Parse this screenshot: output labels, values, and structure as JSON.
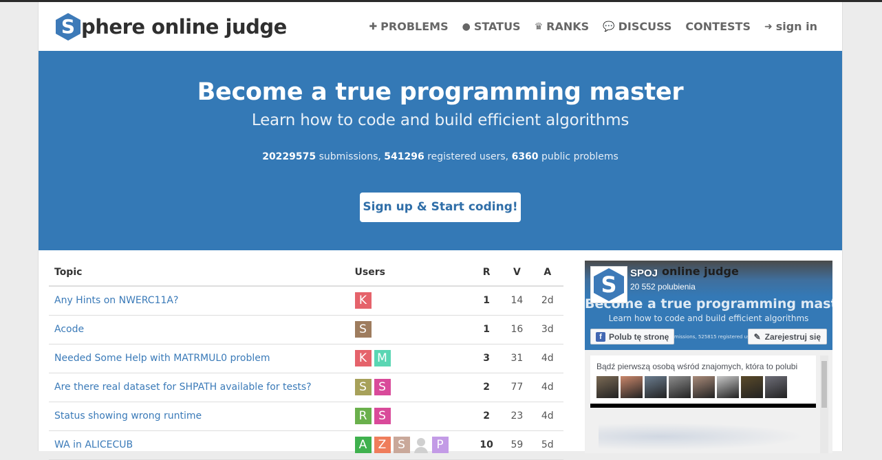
{
  "header": {
    "logo_letter": "S",
    "logo_text": "phere online judge",
    "nav": [
      {
        "label": "PROBLEMS",
        "icon": "puzzle-icon",
        "glyph": "✚"
      },
      {
        "label": "STATUS",
        "icon": "circle-icon",
        "glyph": "●"
      },
      {
        "label": "RANKS",
        "icon": "trophy-icon",
        "glyph": "♛"
      },
      {
        "label": "DISCUSS",
        "icon": "comments-icon",
        "glyph": "💬"
      },
      {
        "label": "CONTESTS",
        "icon": "",
        "glyph": ""
      },
      {
        "label": "sign in",
        "icon": "sign-in-icon",
        "glyph": "➜"
      }
    ]
  },
  "hero": {
    "title": "Become a true programming master",
    "subtitle": "Learn how to code and build efficient algorithms",
    "submissions": "20229575",
    "submissions_label": " submissions, ",
    "users": "541296",
    "users_label": " registered users, ",
    "problems": "6360",
    "problems_label": " public problems",
    "cta": "Sign up & Start coding!"
  },
  "forum": {
    "columns": [
      "Topic",
      "Users",
      "R",
      "V",
      "A"
    ],
    "rows": [
      {
        "topic": "Any Hints on NWERC11A?",
        "users": [
          {
            "letter": "K",
            "color": "#e5636b"
          }
        ],
        "r": "1",
        "v": "14",
        "a": "2d"
      },
      {
        "topic": "Acode",
        "users": [
          {
            "letter": "S",
            "color": "#9e7c5e"
          }
        ],
        "r": "1",
        "v": "16",
        "a": "3d"
      },
      {
        "topic": "Needed Some Help with MATRMUL0 problem",
        "users": [
          {
            "letter": "K",
            "color": "#e5636b"
          },
          {
            "letter": "M",
            "color": "#5ad6b3"
          }
        ],
        "r": "3",
        "v": "31",
        "a": "4d"
      },
      {
        "topic": "Are there real dataset for SHPATH available for tests?",
        "users": [
          {
            "letter": "S",
            "color": "#a7a15a"
          },
          {
            "letter": "S",
            "color": "#d94a9a"
          }
        ],
        "r": "2",
        "v": "77",
        "a": "4d"
      },
      {
        "topic": "Status showing wrong runtime",
        "users": [
          {
            "letter": "R",
            "color": "#6ab04c"
          },
          {
            "letter": "S",
            "color": "#d94a9a"
          }
        ],
        "r": "2",
        "v": "23",
        "a": "4d"
      },
      {
        "topic": "WA in ALICECUB",
        "users": [
          {
            "letter": "A",
            "color": "#3fb14e"
          },
          {
            "letter": "Z",
            "color": "#ef7d5b"
          },
          {
            "letter": "S",
            "color": "#c9a89a"
          },
          {
            "letter": "",
            "color": "ghost"
          },
          {
            "letter": "P",
            "color": "#c39be6"
          }
        ],
        "r": "10",
        "v": "59",
        "a": "5d"
      }
    ]
  },
  "facebook": {
    "page_name": "SPOJ",
    "likes": "20 552 polubienia",
    "cover_title": "Become a true programming master",
    "cover_sub": "Learn how to code and build efficient algorithms",
    "cover_logotext": "online judge",
    "cover_stats": "missions, 525815 registered users, 6",
    "like_button": "Polub tę stronę",
    "register_button": "Zarejestruj się",
    "friends_text": "Bądź pierwszą osobą wśród znajomych, która to polubi",
    "face_colors": [
      "#7b6a55",
      "#c9876b",
      "#6b7d8f",
      "#8d8d8d",
      "#a98b7a",
      "#c7c7c7",
      "#5a4a2a",
      "#6e6e78"
    ]
  }
}
